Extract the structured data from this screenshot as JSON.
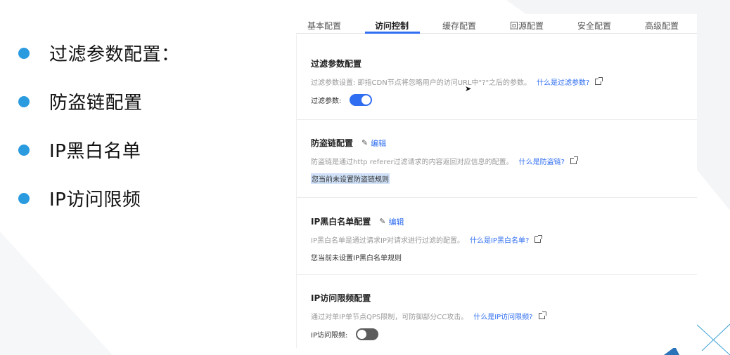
{
  "bullets": [
    {
      "label": "过滤参数配置："
    },
    {
      "label": "防盗链配置"
    },
    {
      "label": "IP黑白名单"
    },
    {
      "label": "IP访问限频"
    }
  ],
  "tabs": [
    {
      "label": "基本配置",
      "active": false
    },
    {
      "label": "访问控制",
      "active": true
    },
    {
      "label": "缓存配置",
      "active": false
    },
    {
      "label": "回源配置",
      "active": false
    },
    {
      "label": "安全配置",
      "active": false
    },
    {
      "label": "高级配置",
      "active": false
    }
  ],
  "sections": {
    "filter": {
      "title": "过滤参数配置",
      "desc": "过滤参数设置: 即指CDN节点将忽略用户的访问URL中\"?\"之后的参数。",
      "link": "什么是过滤参数?",
      "toggle_label": "过滤参数:",
      "toggle_on": true
    },
    "hotlink": {
      "title": "防盗链配置",
      "edit_label": "编辑",
      "desc": "防盗链是通过http referer过滤请求的内容返回对应信息的配置。",
      "link": "什么是防盗链?",
      "status": "您当前未设置防盗链规则"
    },
    "ipacl": {
      "title": "IP黑白名单配置",
      "edit_label": "编辑",
      "desc": "IP黑白名单是通过请求IP对请求进行过滤的配置。",
      "link": "什么是IP黑白名单?",
      "status": "您当前未设置IP黑白名单规则"
    },
    "ratelimit": {
      "title": "IP访问限频配置",
      "desc": "通过对单IP单节点QPS限制，可防御部分CC攻击。",
      "link": "什么是IP访问限频?",
      "toggle_label": "IP访问限频:",
      "toggle_on": false
    }
  },
  "colors": {
    "accent": "#2f6ef0",
    "bullet": "#2b9be0",
    "toggle_off": "#5c5c5c",
    "highlight": "#cfe0f7"
  },
  "icons": {
    "bullet": "bullet-dot-icon",
    "edit": "pencil-icon",
    "external_link": "external-link-icon",
    "cursor": "mouse-cursor-icon"
  }
}
